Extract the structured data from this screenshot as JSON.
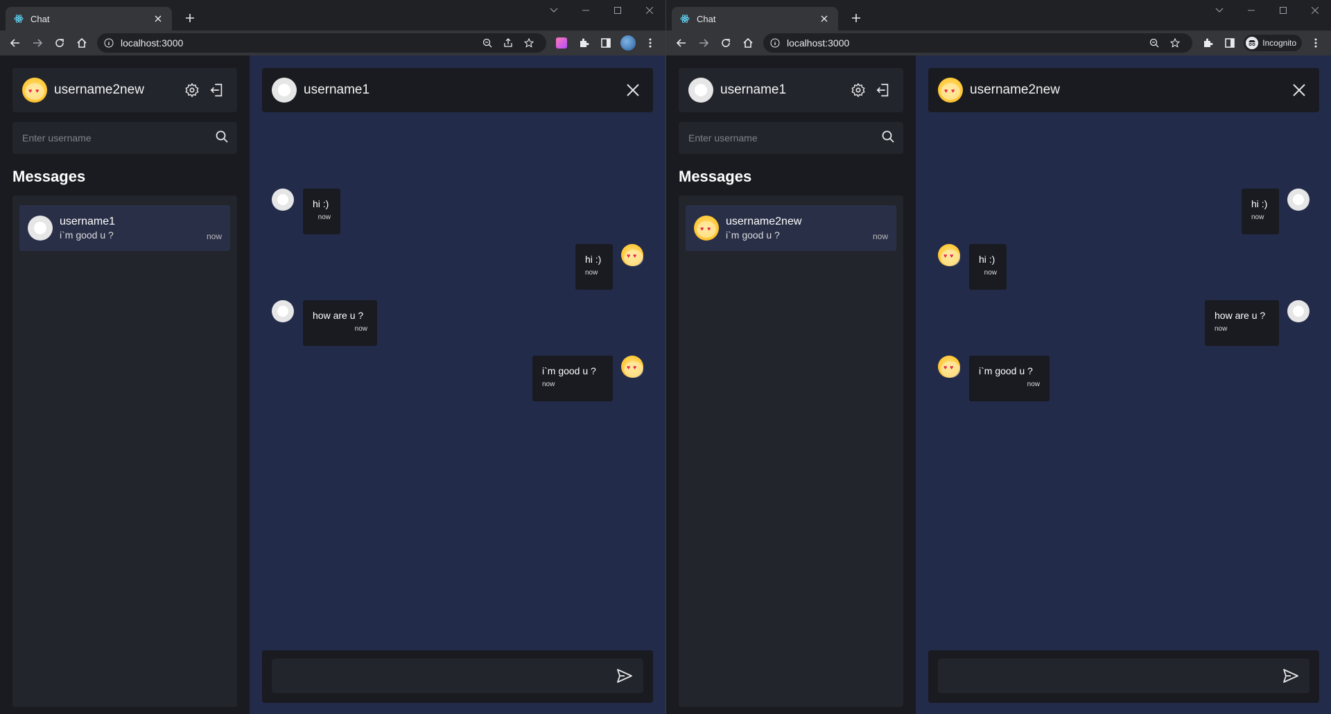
{
  "left": {
    "tab": {
      "title": "Chat"
    },
    "url": "localhost:3000",
    "sidebar": {
      "username": "username2new",
      "search_placeholder": "Enter username",
      "messages_heading": "Messages",
      "conversation": {
        "name": "username1",
        "last": "i`m good u ?",
        "time": "now"
      }
    },
    "chat": {
      "partner": "username1",
      "messages": [
        {
          "text": "hi :)",
          "time": "now"
        },
        {
          "text": "hi :)",
          "time": "now"
        },
        {
          "text": "how are u ?",
          "time": "now"
        },
        {
          "text": "i`m good u ?",
          "time": "now"
        }
      ]
    }
  },
  "right": {
    "tab": {
      "title": "Chat"
    },
    "url": "localhost:3000",
    "incognito_label": "Incognito",
    "sidebar": {
      "username": "username1",
      "search_placeholder": "Enter username",
      "messages_heading": "Messages",
      "conversation": {
        "name": "username2new",
        "last": "i`m good u ?",
        "time": "now"
      }
    },
    "chat": {
      "partner": "username2new",
      "messages": [
        {
          "text": "hi :)",
          "time": "now"
        },
        {
          "text": "hi :)",
          "time": "now"
        },
        {
          "text": "how are u ?",
          "time": "now"
        },
        {
          "text": "i`m good u ?",
          "time": "now"
        }
      ]
    }
  }
}
